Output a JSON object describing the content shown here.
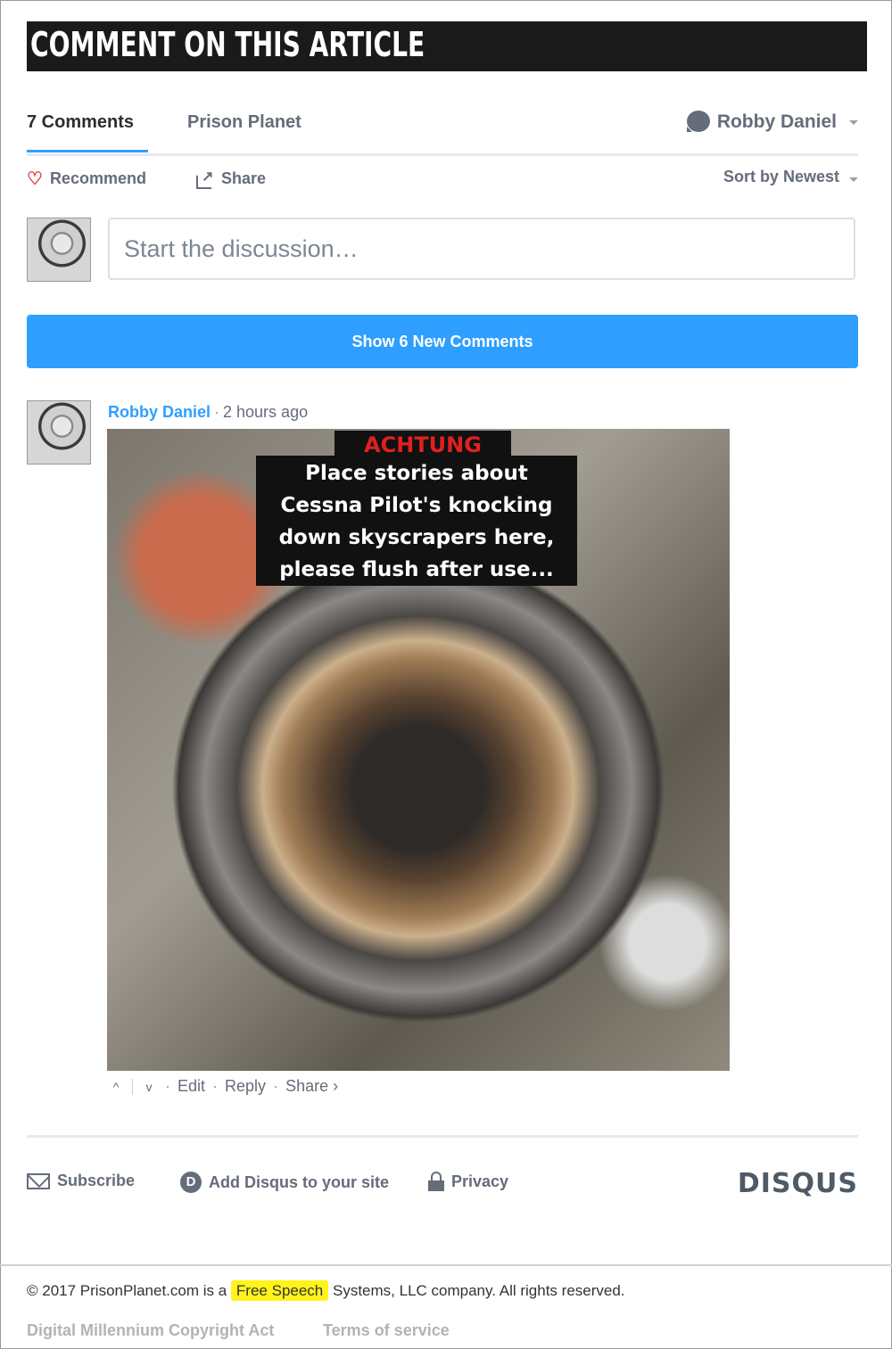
{
  "header": {
    "title": "COMMENT ON THIS ARTICLE"
  },
  "tabs": {
    "comments": "7 Comments",
    "forum": "Prison Planet"
  },
  "user_menu": {
    "name": "Robby Daniel"
  },
  "actions": {
    "recommend": "Recommend",
    "share": "Share",
    "sort": "Sort by Newest"
  },
  "composer": {
    "placeholder": "Start the discussion…"
  },
  "new_comments_button": "Show 6 New Comments",
  "comment": {
    "author": "Robby Daniel",
    "separator": "·",
    "time": "2 hours ago",
    "image": {
      "title": "ACHTUNG",
      "caption": [
        "Place stories about",
        "Cessna Pilot's knocking",
        "down skyscrapers here,",
        "please flush after use..."
      ]
    },
    "footer": {
      "upvote": "^",
      "downvote": "v",
      "edit": "Edit",
      "reply": "Reply",
      "share": "Share ›"
    }
  },
  "bottom_links": {
    "subscribe": "Subscribe",
    "add_disqus": "Add Disqus to your site",
    "privacy": "Privacy",
    "logo": "DISQUS"
  },
  "site_footer": {
    "copyright_pre": "© 2017 PrisonPlanet.com is a ",
    "highlight": "Free Speech",
    "copyright_post": " Systems, LLC company. All rights reserved.",
    "dmca": "Digital Millennium Copyright Act",
    "terms": "Terms of service"
  },
  "colors": {
    "accent": "#2e9fff",
    "highlight": "#fff31a",
    "heart": "#e03a3a"
  },
  "icons": [
    "heart-icon",
    "share-icon",
    "chat-bubble-icon",
    "chevron-down-icon",
    "mail-icon",
    "disqus-d-icon",
    "lock-icon"
  ]
}
